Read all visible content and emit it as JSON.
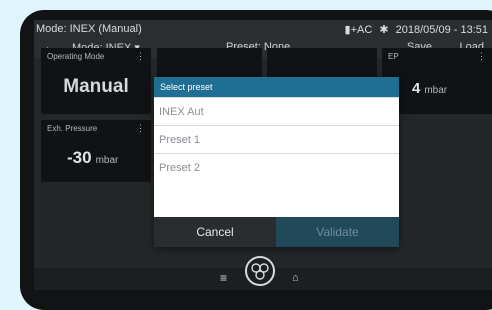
{
  "status": {
    "title": "Mode: INEX (Manual)",
    "power": "▮+AC",
    "bluetooth": "✱",
    "datetime": "2018/05/09 - 13:51"
  },
  "toolbar": {
    "back": "←",
    "mode": "Mode: INEX ▾",
    "preset": "Preset: None",
    "save": "Save",
    "load": "Load"
  },
  "tiles": {
    "operating_mode": {
      "label": "Operating Mode",
      "value": "Manual",
      "menu": "⋮"
    },
    "peep": {
      "label": "EP",
      "value": "4",
      "unit": "mbar",
      "menu": "⋮"
    },
    "exh_pressure": {
      "label": "Exh. Pressure",
      "value": "-30",
      "unit": "mbar",
      "menu": "⋮"
    }
  },
  "dialog": {
    "title": "Select preset",
    "options": [
      "INEX Aut",
      "Preset 1",
      "Preset 2"
    ],
    "cancel": "Cancel",
    "validate": "Validate"
  },
  "bottombar": {
    "menu_icon": "≡",
    "home_icon": "⌂"
  },
  "colors": {
    "accent": "#1f6f94",
    "validate_bg": "#21495a",
    "background": "#dff4fb"
  }
}
